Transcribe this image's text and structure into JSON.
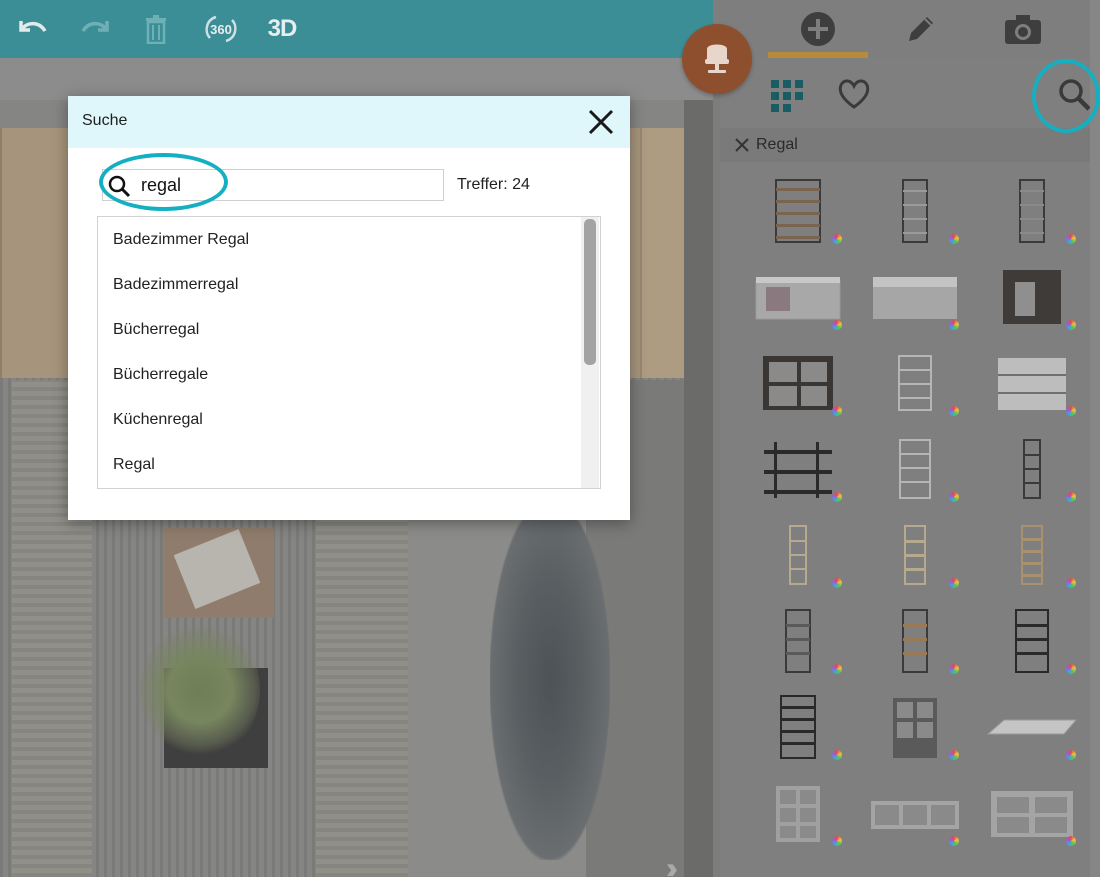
{
  "toolbar": {
    "undo_icon": "undo-icon",
    "redo_icon": "redo-icon",
    "delete_icon": "trash-icon",
    "view360_label": "360",
    "view3d_label": "3D",
    "bar_color": "#3c8e96"
  },
  "sidebar": {
    "tabs": [
      {
        "icon": "plus-icon",
        "active": true
      },
      {
        "icon": "pencil-icon",
        "active": false
      },
      {
        "icon": "camera-icon",
        "active": false
      }
    ],
    "subtabs": [
      {
        "icon": "grid-icon"
      },
      {
        "icon": "heart-icon"
      },
      {
        "icon": "search-icon"
      }
    ],
    "filter_chip": "Regal",
    "accent_color": "#b88a3c"
  },
  "dialog": {
    "title": "Suche",
    "search_value": "regal",
    "hits_label": "Treffer: 24",
    "results": [
      "Badezimmer Regal",
      "Badezimmerregal",
      "Bücherregal",
      "Bücherregale",
      "Küchenregal",
      "Regal"
    ]
  },
  "highlight_color": "#14b0c2",
  "fab_icon": "chair-icon"
}
